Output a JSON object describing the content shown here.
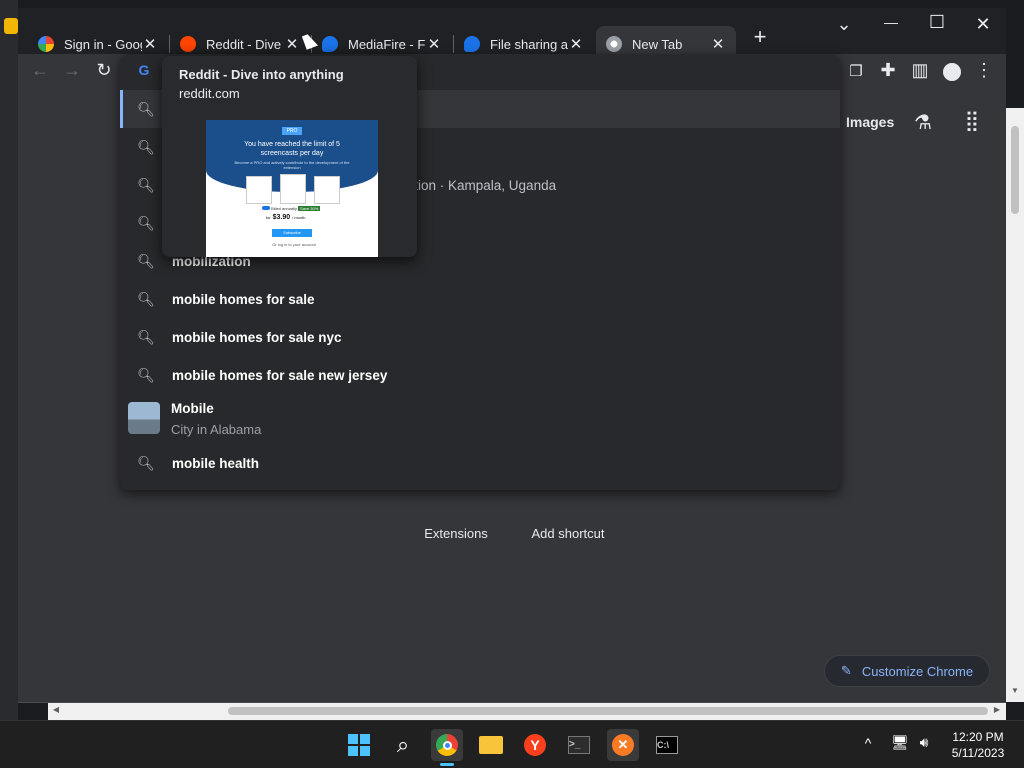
{
  "browser": {
    "tabs": [
      {
        "title": "Sign in - Google",
        "favicon": "google-icon",
        "close": "✕"
      },
      {
        "title": "Reddit - Dive into anything",
        "favicon": "reddit-icon",
        "close": "✕"
      },
      {
        "title": "MediaFire - File sharing",
        "favicon": "mediafire-icon",
        "close": "✕"
      },
      {
        "title": "File sharing and storage",
        "favicon": "mediafire-icon",
        "close": "✕"
      },
      {
        "title": "New Tab",
        "favicon": "chrome-icon",
        "close": "✕"
      }
    ],
    "new_tab": "+",
    "window_controls": {
      "dropdown": "⌄",
      "minimize": "—",
      "maximize": "☐",
      "close": "✕"
    }
  },
  "tooltip": {
    "title": "Reddit - Dive into anything",
    "domain": "reddit.com"
  },
  "thumbnail": {
    "logo": "PRO",
    "headline": "You have reached the limit of 5 screencasts per day",
    "sub": "Become a PRO and actively contribute to the development of the extension",
    "toggle_label": "Billed annually",
    "discount": "Save 30%",
    "price_prefix": "for",
    "price": "$3.90",
    "price_suffix": "/ month",
    "button": "Subscribe",
    "footer": "Or log in to your account"
  },
  "omnibox": {
    "suggestions": [
      {
        "text": "",
        "icon": "search-icon"
      },
      {
        "text": "",
        "icon": "search-icon"
      },
      {
        "text": "",
        "icon": "search-icon",
        "hint": "zation · Kampala, Uganda"
      },
      {
        "text": "",
        "icon": "search-icon"
      },
      {
        "text": "mobilization",
        "icon": "search-icon"
      },
      {
        "text": "mobile homes for sale",
        "icon": "search-icon"
      },
      {
        "text": "mobile homes for sale nyc",
        "icon": "search-icon"
      },
      {
        "text": "mobile homes for sale new jersey",
        "icon": "search-icon"
      }
    ],
    "entity": {
      "title": "Mobile",
      "subtitle": "City in Alabama"
    },
    "last": {
      "text": "mobile health",
      "icon": "search-icon"
    }
  },
  "ntp": {
    "images_link": "Images",
    "shortcuts": [
      {
        "label": "Extensions"
      },
      {
        "label": "Add shortcut"
      }
    ],
    "customize": "Customize Chrome"
  },
  "taskbar": {
    "time": "12:20 PM",
    "date": "5/11/2023"
  },
  "colors": {
    "accent": "#8ab4f8",
    "reddit": "#ff4500",
    "mediafire": "#1a73e8"
  }
}
